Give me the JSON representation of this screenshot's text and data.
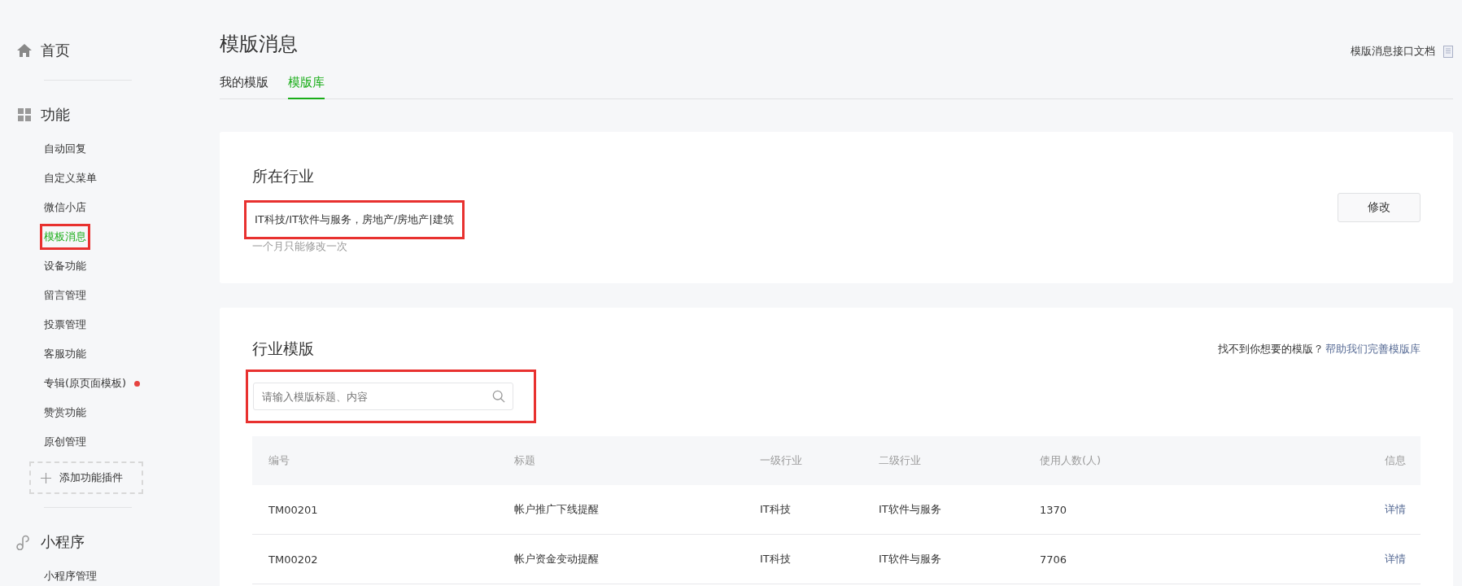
{
  "sidebar": {
    "sections": [
      {
        "kind": "home",
        "label": "首页"
      },
      {
        "kind": "grid",
        "label": "功能",
        "items": [
          {
            "label": "自动回复",
            "selected": false,
            "highlighted": false,
            "dot": false
          },
          {
            "label": "自定义菜单",
            "selected": false,
            "highlighted": false,
            "dot": false
          },
          {
            "label": "微信小店",
            "selected": false,
            "highlighted": false,
            "dot": false
          },
          {
            "label": "模板消息",
            "selected": true,
            "highlighted": true,
            "dot": false
          },
          {
            "label": "设备功能",
            "selected": false,
            "highlighted": false,
            "dot": false
          },
          {
            "label": "留言管理",
            "selected": false,
            "highlighted": false,
            "dot": false
          },
          {
            "label": "投票管理",
            "selected": false,
            "highlighted": false,
            "dot": false
          },
          {
            "label": "客服功能",
            "selected": false,
            "highlighted": false,
            "dot": false
          },
          {
            "label": "专辑(原页面模板)",
            "selected": false,
            "highlighted": false,
            "dot": true
          },
          {
            "label": "赞赏功能",
            "selected": false,
            "highlighted": false,
            "dot": false
          },
          {
            "label": "原创管理",
            "selected": false,
            "highlighted": false,
            "dot": false
          }
        ],
        "add_button": "添加功能插件"
      },
      {
        "kind": "link",
        "label": "小程序",
        "items": [
          {
            "label": "小程序管理",
            "selected": false,
            "highlighted": false,
            "dot": false
          }
        ]
      }
    ]
  },
  "page": {
    "title": "模版消息",
    "doc_link": "模版消息接口文档",
    "tabs": [
      {
        "label": "我的模版",
        "selected": false
      },
      {
        "label": "模版库",
        "selected": true
      }
    ]
  },
  "industry_card": {
    "title": "所在行业",
    "value": "IT科技/IT软件与服务，房地产/房地产|建筑",
    "value_highlighted": true,
    "note": "一个月只能修改一次",
    "button": "修改"
  },
  "template_card": {
    "title": "行业模版",
    "help_text": "找不到你想要的模版？",
    "help_link": "帮助我们完善模版库",
    "search": {
      "placeholder": "请输入模版标题、内容",
      "highlighted": true
    },
    "table": {
      "columns": [
        "编号",
        "标题",
        "一级行业",
        "二级行业",
        "使用人数(人)",
        "信息"
      ],
      "rows": [
        [
          "TM00201",
          "帐户推广下线提醒",
          "IT科技",
          "IT软件与服务",
          "1370",
          "详情"
        ],
        [
          "TM00202",
          "帐户资金变动提醒",
          "IT科技",
          "IT软件与服务",
          "7706",
          "详情"
        ]
      ]
    }
  }
}
